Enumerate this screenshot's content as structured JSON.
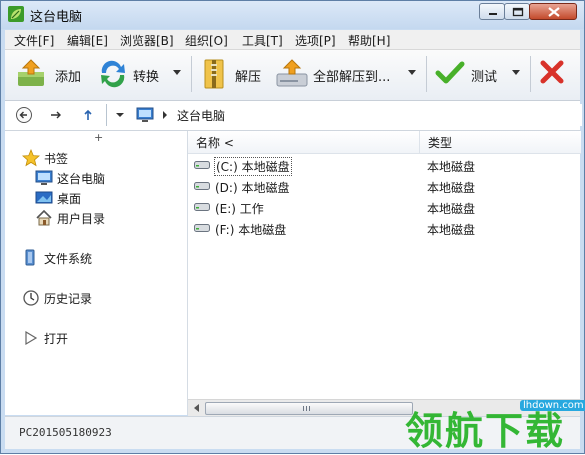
{
  "window": {
    "title": "这台电脑"
  },
  "menu": [
    {
      "label": "文件[F]"
    },
    {
      "label": "编辑[E]"
    },
    {
      "label": "浏览器[B]"
    },
    {
      "label": "组织[O]"
    },
    {
      "label": "工具[T]"
    },
    {
      "label": "选项[P]"
    },
    {
      "label": "帮助[H]"
    }
  ],
  "toolbar": {
    "add": "添加",
    "convert": "转换",
    "extract": "解压",
    "extract_all": "全部解压到...",
    "test": "测试"
  },
  "address": {
    "path": "这台电脑"
  },
  "tree": {
    "bookmarks": "书签",
    "this_pc": "这台电脑",
    "desktop": "桌面",
    "user_dir": "用户目录",
    "filesystem": "文件系统",
    "history": "历史记录",
    "open": "打开",
    "plus": "+"
  },
  "columns": {
    "name": "名称 <",
    "type": "类型"
  },
  "rows": [
    {
      "name": "(C:) 本地磁盘",
      "type": "本地磁盘"
    },
    {
      "name": "(D:) 本地磁盘",
      "type": "本地磁盘"
    },
    {
      "name": "(E:) 工作",
      "type": "本地磁盘"
    },
    {
      "name": "(F:) 本地磁盘",
      "type": "本地磁盘"
    }
  ],
  "status": {
    "computer": "PC201505180923"
  },
  "watermark": {
    "text": "领航下载",
    "url": "lhdown.com"
  },
  "colors": {
    "accent": "#25b225",
    "title_bg": "#c4d8ef",
    "close": "#c34a2c"
  }
}
